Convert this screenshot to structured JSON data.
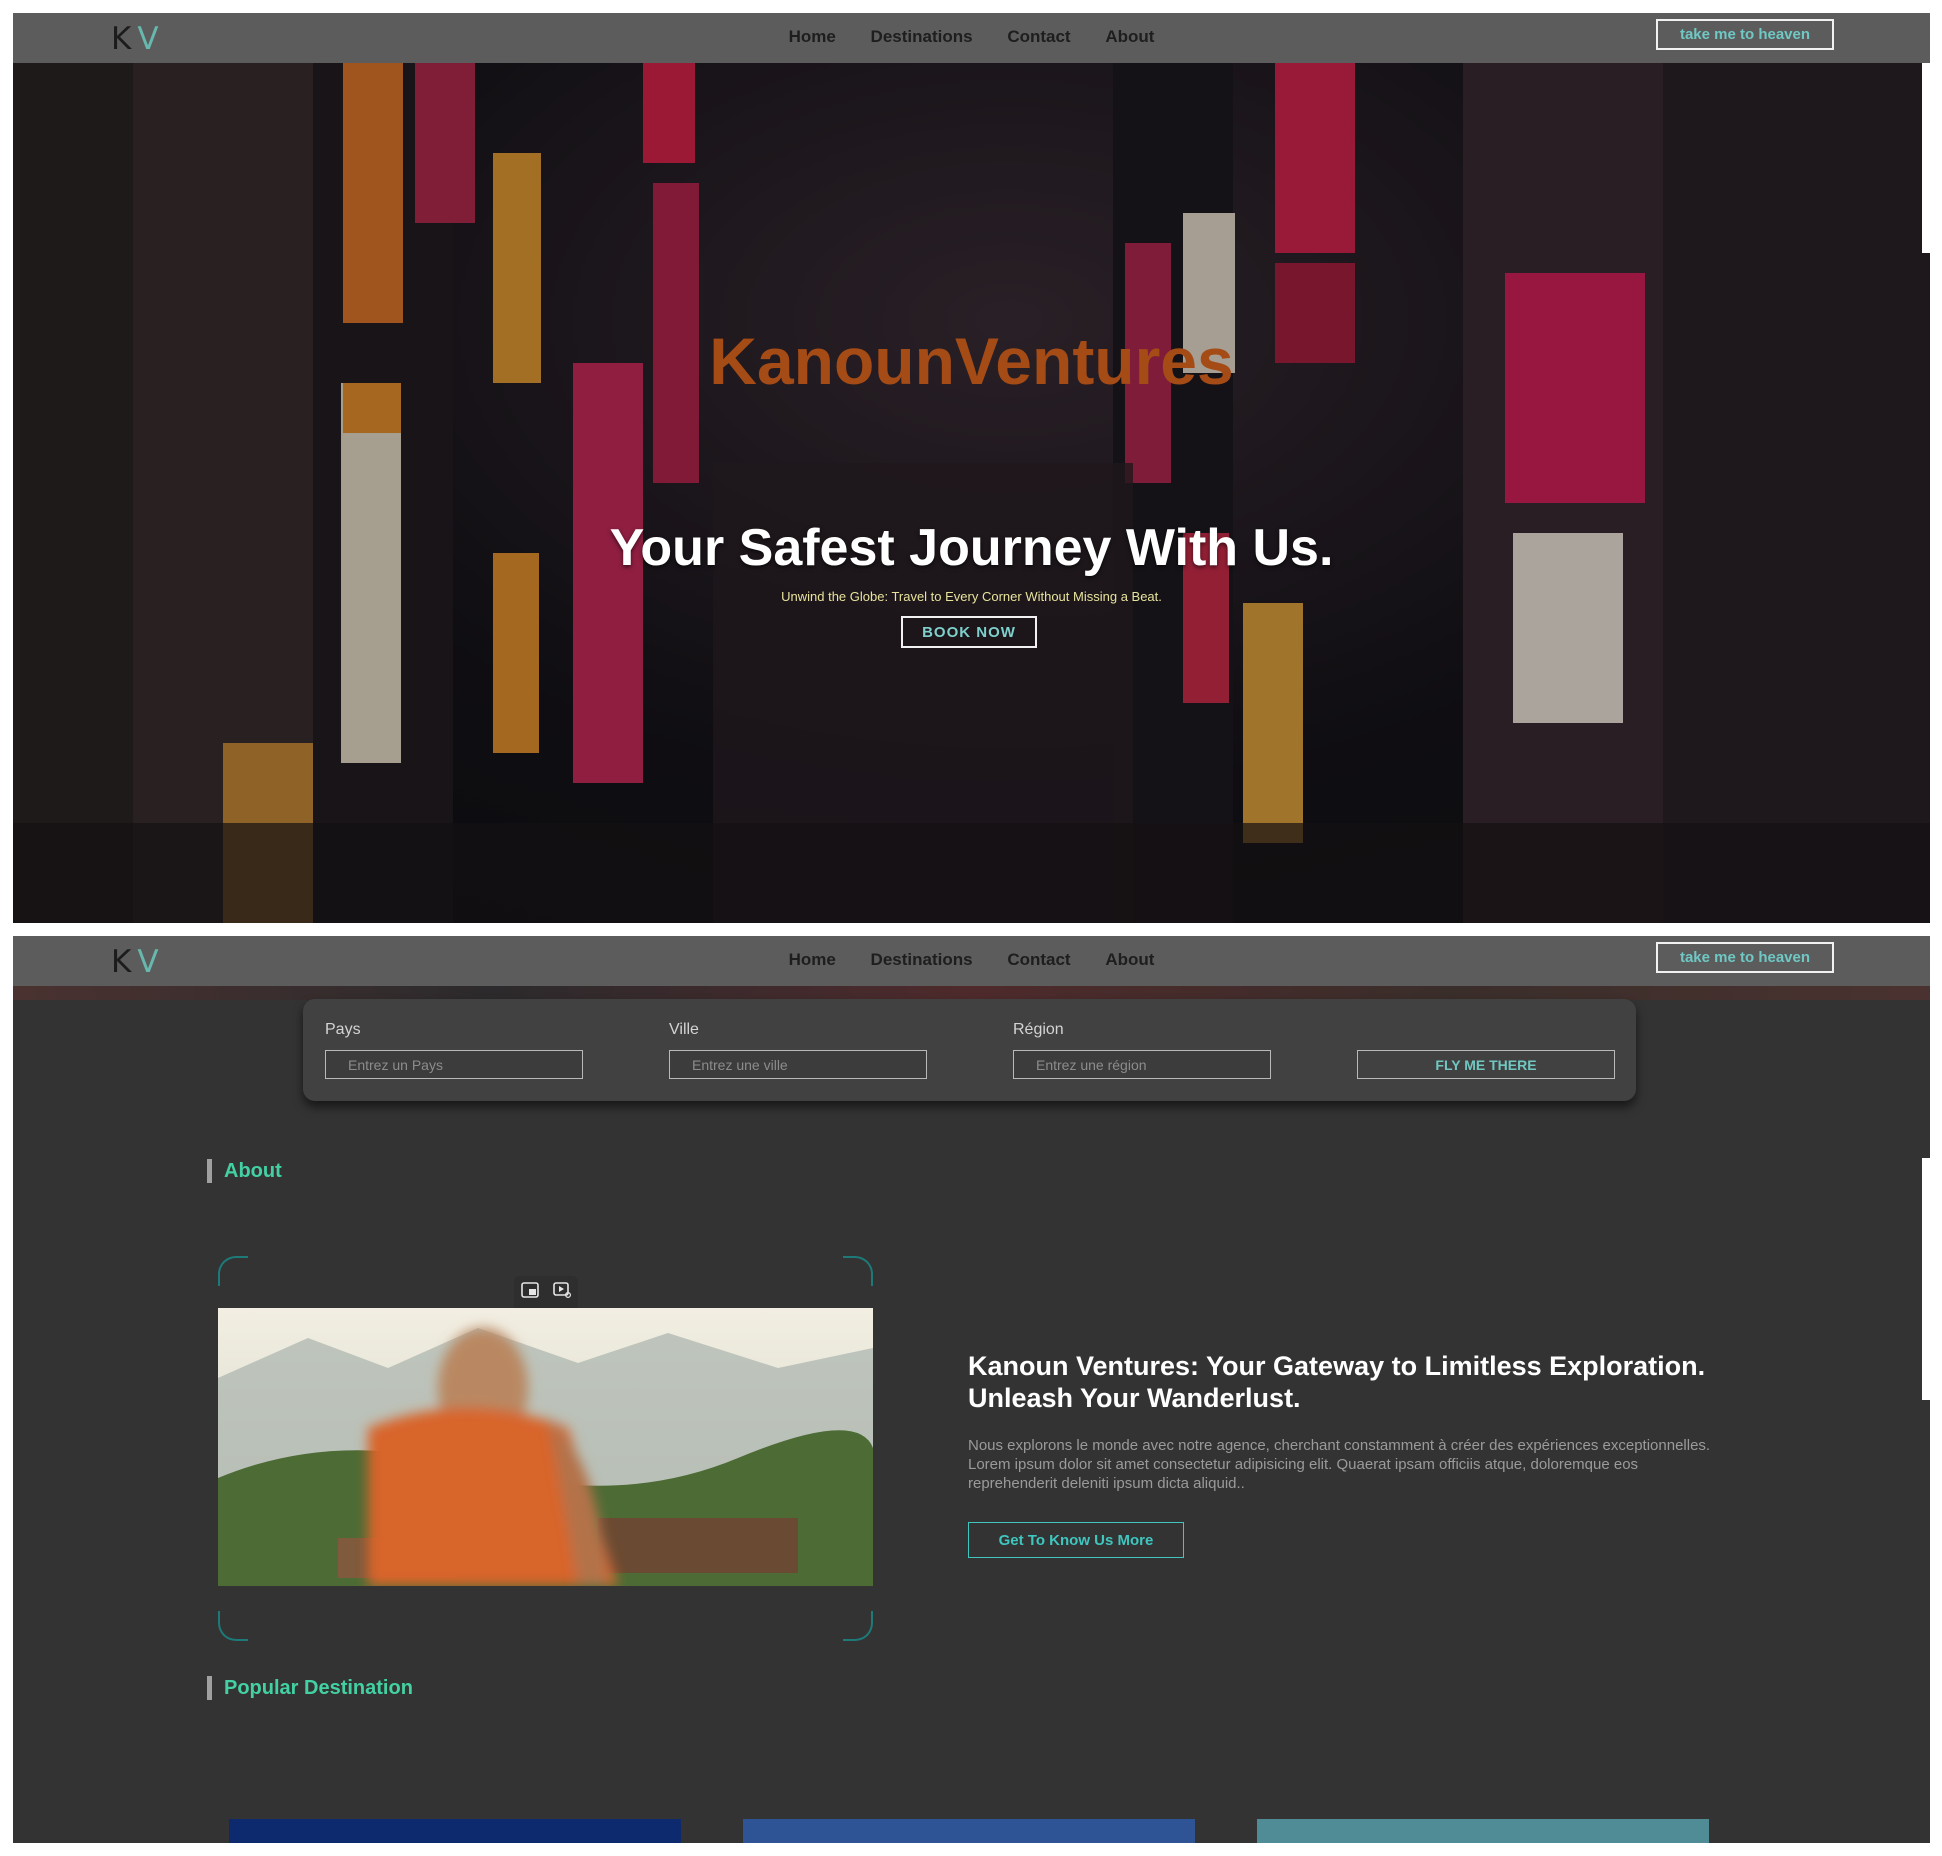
{
  "nav": {
    "logo_k": "K",
    "logo_v": "V",
    "links": [
      "Home",
      "Destinations",
      "Contact",
      "About"
    ],
    "cta": "take me to heaven"
  },
  "hero": {
    "brand": "KanounVentures",
    "headline": "Your Safest Journey With Us.",
    "tagline": "Unwind the Globe: Travel to Every Corner Without Missing a Beat.",
    "button": "BOOK NOW"
  },
  "search": {
    "country_label": "Pays",
    "country_placeholder": "Entrez un Pays",
    "city_label": "Ville",
    "city_placeholder": "Entrez une ville",
    "region_label": "Région",
    "region_placeholder": "Entrez une région",
    "submit": "FLY ME THERE"
  },
  "about": {
    "heading": "About",
    "title": "Kanoun Ventures: Your Gateway to Limitless Exploration. Unleash Your Wanderlust.",
    "text": "Nous explorons le monde avec notre agence, cherchant constamment à créer des expériences exceptionnelles. Lorem ipsum dolor sit amet consectetur adipisicing elit. Quaerat ipsam officiis atque, doloremque eos reprehenderit deleniti ipsum dicta aliquid..",
    "button": "Get To Know Us More"
  },
  "popular": {
    "heading": "Popular Destination"
  },
  "colors": {
    "accent": "#43d1a3",
    "teal": "#3ec6bf",
    "brand_orange": "#a54b16",
    "navbar": "#5c5c5c"
  }
}
